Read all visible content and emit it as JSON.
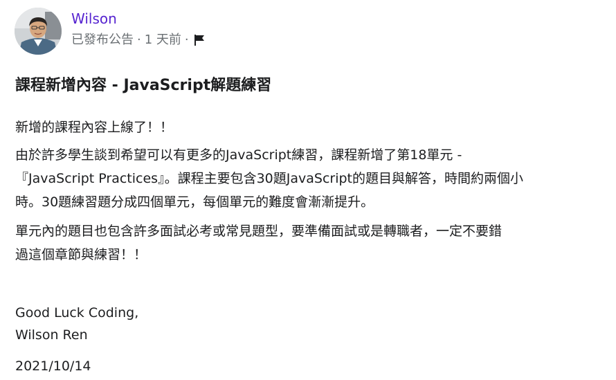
{
  "author": {
    "name": "Wilson",
    "avatar_icon": "user-avatar-photo"
  },
  "meta": {
    "status": "已發布公告",
    "separator": "·",
    "time": "1 天前",
    "flag_icon": "flag-icon"
  },
  "post": {
    "title": "課程新增內容 - JavaScript解題練習",
    "paragraphs": [
      [
        "新增的課程內容上線了！！"
      ],
      [
        "由於許多學生談到希望可以有更多的JavaScript練習，課程新增了第18單元 -",
        "『JavaScript Practices』。課程主要包含30題JavaScript的題目與解答，時間約兩個小",
        "時。30題練習題分成四個單元，每個單元的難度會漸漸提升。"
      ],
      [
        "單元內的題目也包含許多面試必考或常見題型，要準備面試或是轉職者，一定不要錯",
        "過這個章節與練習！！"
      ]
    ],
    "closing": [
      "Good Luck Coding,",
      "Wilson Ren"
    ],
    "date": "2021/10/14"
  },
  "colors": {
    "author_link": "#5624d0",
    "meta_text": "#6a6f73",
    "body_text": "#1c1d1f"
  }
}
